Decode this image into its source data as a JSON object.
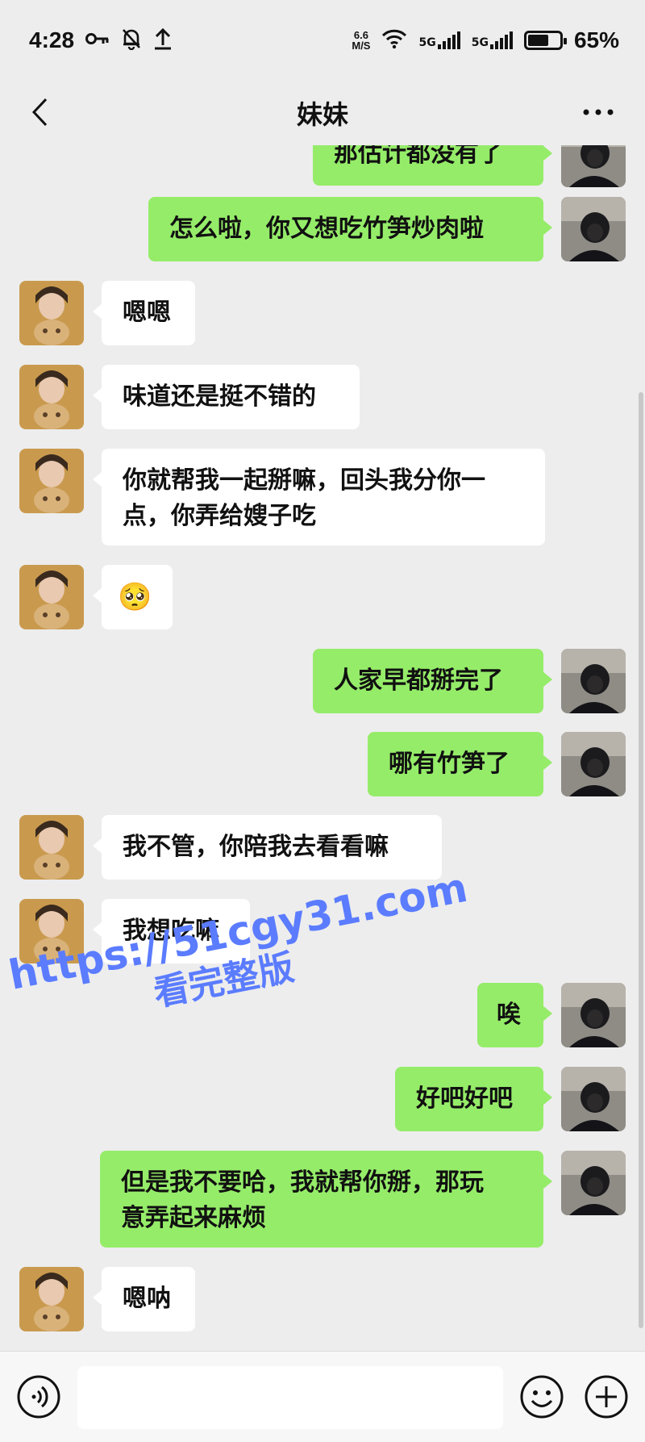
{
  "status_bar": {
    "time": "4:28",
    "net_speed_value": "6.6",
    "net_speed_unit": "M/S",
    "sim1_label": "5G",
    "sim2_label": "5G",
    "battery_text": "65%",
    "battery_level": 0.65,
    "icons": [
      "key-icon",
      "bell-muted-icon",
      "upload-icon",
      "wifi-icon",
      "signal-icon",
      "battery-icon"
    ]
  },
  "header": {
    "title": "妹妹",
    "back_icon": "chevron-left-icon",
    "more_icon": "more-dots-icon"
  },
  "messages": [
    {
      "side": "right",
      "text": "那估计都没有了"
    },
    {
      "side": "right",
      "text": "怎么啦，你又想吃竹笋炒肉啦"
    },
    {
      "side": "left",
      "text": "嗯嗯"
    },
    {
      "side": "left",
      "text": "味道还是挺不错的"
    },
    {
      "side": "left",
      "text": "你就帮我一起掰嘛，回头我分你一点，你弄给嫂子吃"
    },
    {
      "side": "left",
      "text": "🥺"
    },
    {
      "side": "right",
      "text": "人家早都掰完了"
    },
    {
      "side": "right",
      "text": "哪有竹笋了"
    },
    {
      "side": "left",
      "text": "我不管，你陪我去看看嘛"
    },
    {
      "side": "left",
      "text": "我想吃嘛"
    },
    {
      "side": "right",
      "text": "唉"
    },
    {
      "side": "right",
      "text": "好吧好吧"
    },
    {
      "side": "right",
      "text": "但是我不要哈，我就帮你掰，那玩意弄起来麻烦"
    },
    {
      "side": "left",
      "text": "嗯呐"
    }
  ],
  "message_lines": {
    "m4_line1": "你就帮我一起掰嘛，回头我分你一",
    "m4_line2": "点，你弄给嫂子吃",
    "m12_line1": "但是我不要哈，我就帮你掰，那玩",
    "m12_line2": "意弄起来麻烦"
  },
  "watermark": {
    "url": "https://51cgy31.com",
    "subtitle": "看完整版"
  },
  "input_bar": {
    "value": "",
    "icons": [
      "voice-icon",
      "emoji-icon",
      "plus-icon"
    ]
  },
  "colors": {
    "background": "#ededed",
    "outgoing_bubble": "#95ec69",
    "incoming_bubble": "#ffffff",
    "watermark": "#5b7cff"
  }
}
